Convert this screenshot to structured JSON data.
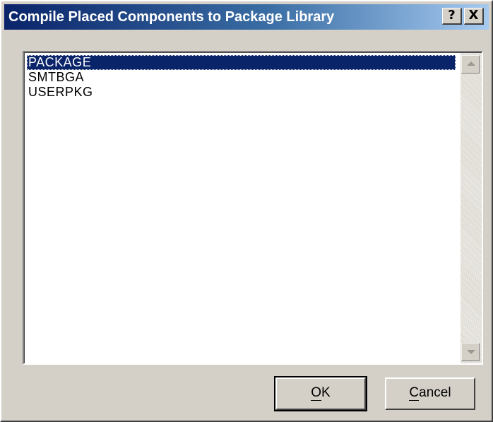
{
  "window": {
    "title": "Compile Placed Components to Package Library",
    "help_label": "?",
    "close_label": "X"
  },
  "list": {
    "items": [
      {
        "label": "PACKAGE",
        "selected": true
      },
      {
        "label": "SMTBGA",
        "selected": false
      },
      {
        "label": "USERPKG",
        "selected": false
      }
    ]
  },
  "buttons": {
    "ok": {
      "mnemonic": "O",
      "rest": "K"
    },
    "cancel": {
      "mnemonic": "C",
      "rest": "ancel"
    }
  },
  "colors": {
    "title_bar_start": "#0a246a",
    "title_bar_end": "#a6caf0",
    "selection": "#0a246a",
    "face": "#d4d0c8"
  }
}
